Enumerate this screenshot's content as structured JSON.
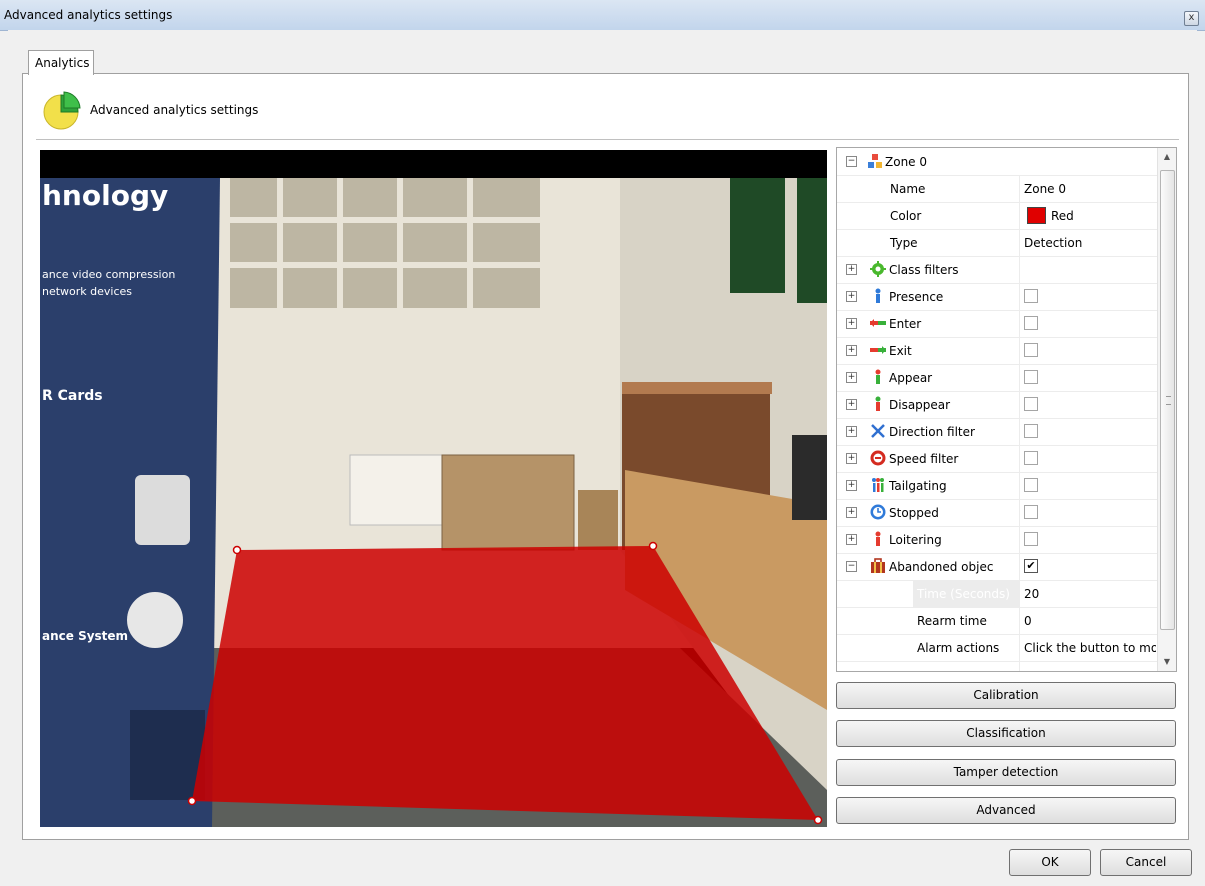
{
  "window": {
    "title": "Advanced analytics settings",
    "close_glyph": "x"
  },
  "tab": {
    "label": "Analytics"
  },
  "header": {
    "icon": "pie-chart-icon",
    "title": "Advanced analytics settings"
  },
  "zone_polygon_color": "#cc0000",
  "property_grid": {
    "zone": {
      "expander": "−",
      "icon": "zone-icon",
      "label": "Zone 0"
    },
    "fields": [
      {
        "label": "Name",
        "value": "Zone 0"
      },
      {
        "label": "Color",
        "value": "Red",
        "swatch": "#e00000"
      },
      {
        "label": "Type",
        "value": "Detection"
      }
    ],
    "class_filters": {
      "label": "Class filters",
      "icon": "gear-icon"
    },
    "rules": [
      {
        "label": "Presence",
        "icon": "person-icon",
        "checked": false
      },
      {
        "label": "Enter",
        "icon": "enter-arrow-icon",
        "checked": false
      },
      {
        "label": "Exit",
        "icon": "exit-arrow-icon",
        "checked": false
      },
      {
        "label": "Appear",
        "icon": "appear-icon",
        "checked": false
      },
      {
        "label": "Disappear",
        "icon": "disappear-icon",
        "checked": false
      },
      {
        "label": "Direction filter",
        "icon": "direction-icon",
        "checked": false
      },
      {
        "label": "Speed filter",
        "icon": "speed-icon",
        "checked": false
      },
      {
        "label": "Tailgating",
        "icon": "tailgating-icon",
        "checked": false
      },
      {
        "label": "Stopped",
        "icon": "clock-icon",
        "checked": false
      },
      {
        "label": "Loitering",
        "icon": "loitering-icon",
        "checked": false
      }
    ],
    "abandoned": {
      "label": "Abandoned objec",
      "icon": "abandoned-object-icon",
      "checked": true,
      "check_glyph": "✔"
    },
    "sub_fields": [
      {
        "label": "Time (Seconds)",
        "value": "20"
      },
      {
        "label": "Rearm time",
        "value": "0"
      },
      {
        "label": "Alarm actions",
        "value": "Click the button to moi"
      }
    ],
    "expand_glyph": "+",
    "scroll_up": "▲",
    "scroll_down": "▼"
  },
  "buttons": {
    "calibration": "Calibration",
    "classification": "Classification",
    "tamper": "Tamper detection",
    "advanced": "Advanced",
    "ok": "OK",
    "cancel": "Cancel"
  },
  "poster_text": [
    "hnology",
    "ance video compression",
    "network devices",
    "R Cards",
    "ance System"
  ]
}
